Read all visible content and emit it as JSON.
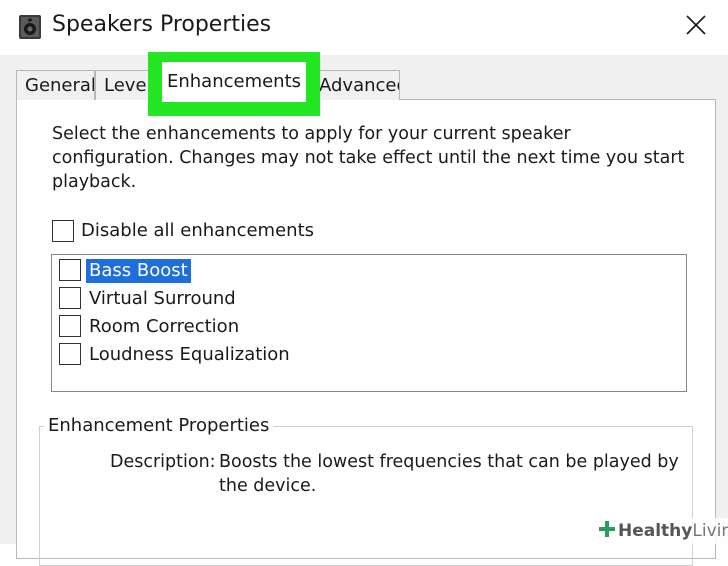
{
  "window": {
    "title": "Speakers Properties",
    "icon": "speaker-icon",
    "close_icon": "close-icon"
  },
  "tabs": [
    {
      "label": "General",
      "active": false
    },
    {
      "label": "Levels",
      "active": false
    },
    {
      "label": "Enhancements",
      "active": true
    },
    {
      "label": "Advanced",
      "active": false
    }
  ],
  "enhancements": {
    "intro": "Select the enhancements to apply for your current speaker configuration. Changes may not take effect until the next time you start playback.",
    "disable_all_label": "Disable all enhancements",
    "items": [
      {
        "label": "Bass Boost",
        "checked": false,
        "selected": true
      },
      {
        "label": "Virtual Surround",
        "checked": false,
        "selected": false
      },
      {
        "label": "Room Correction",
        "checked": false,
        "selected": false
      },
      {
        "label": "Loudness Equalization",
        "checked": false,
        "selected": false
      }
    ]
  },
  "properties": {
    "legend": "Enhancement Properties",
    "description_label": "Description:",
    "description_text": "Boosts the lowest frequencies that can be played by the device."
  },
  "watermark": {
    "part1": "Healthy",
    "part2": "Living"
  },
  "colors": {
    "highlight": "#22e622",
    "selection": "#1e6fd9",
    "watermark_icon": "#2a9d5c"
  }
}
